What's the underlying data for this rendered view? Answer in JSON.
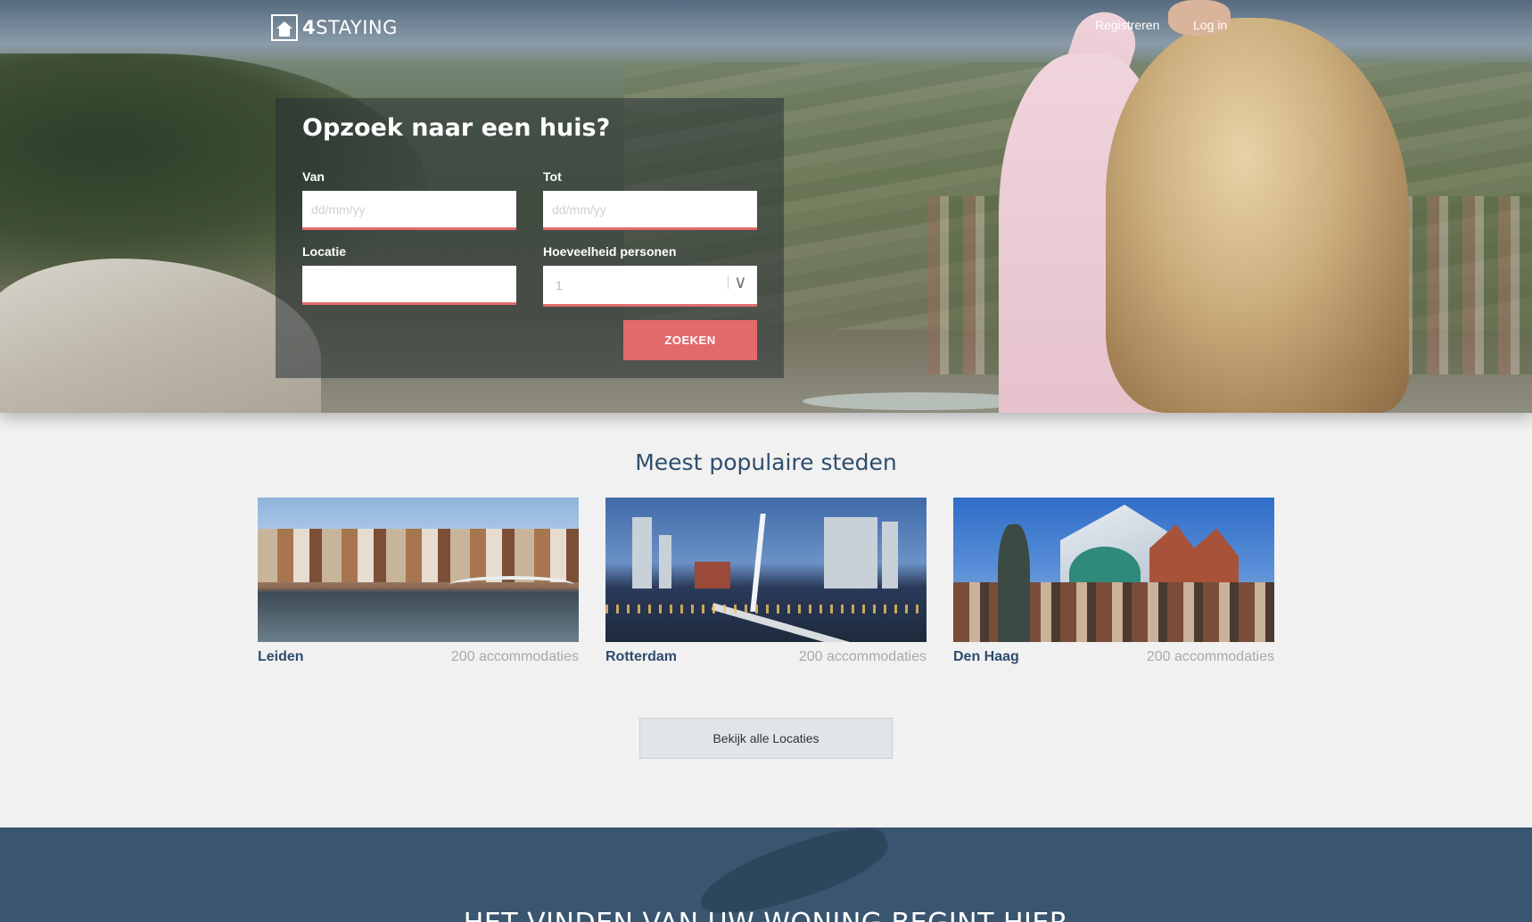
{
  "nav": {
    "logo_bold": "4",
    "logo_text": "STAYING",
    "register": "Registreren",
    "login": "Log in"
  },
  "search": {
    "title": "Opzoek naar een huis?",
    "from_label": "Van",
    "from_placeholder": "dd/mm/yy",
    "to_label": "Tot",
    "to_placeholder": "dd/mm/yy",
    "location_label": "Locatie",
    "location_value": "",
    "persons_label": "Hoeveelheid personen",
    "persons_value": "1",
    "submit": "ZOEKEN"
  },
  "popular": {
    "title": "Meest populaire steden",
    "cities": [
      {
        "name": "Leiden",
        "count": "200 accommodaties"
      },
      {
        "name": "Rotterdam",
        "count": "200 accommodaties"
      },
      {
        "name": "Den Haag",
        "count": "200 accommodaties"
      }
    ],
    "view_all": "Bekijk alle Locaties"
  },
  "band": {
    "title": "HET VINDEN VAN UW WONING BEGINT HIER"
  },
  "colors": {
    "accent": "#e26a6b",
    "heading": "#2e4d6d",
    "band": "#3a556f"
  }
}
